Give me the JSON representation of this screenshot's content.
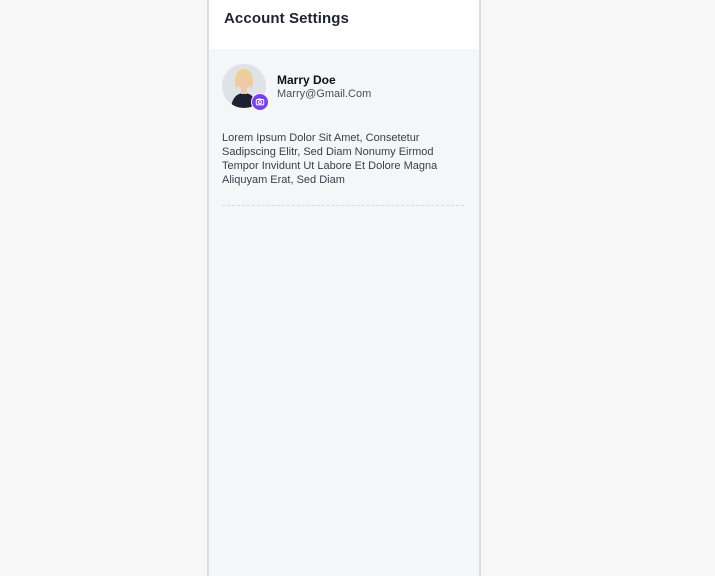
{
  "page": {
    "title": "Account Settings"
  },
  "profile": {
    "name": "Marry Doe",
    "email": "Marry@Gmail.Com",
    "bio": "Lorem Ipsum Dolor Sit Amet, Consetetur Sadipscing Elitr, Sed Diam Nonumy Eirmod Tempor Invidunt Ut Labore Et Dolore Magna Aliquyam Erat, Sed Diam",
    "camera_icon": "camera-icon"
  },
  "colors": {
    "accent": "#7a3ff2",
    "panel_bg": "#f5f6f8",
    "header_bg": "#ffffff",
    "page_bg": "#f8f8f8",
    "title_text": "#1f2430"
  }
}
